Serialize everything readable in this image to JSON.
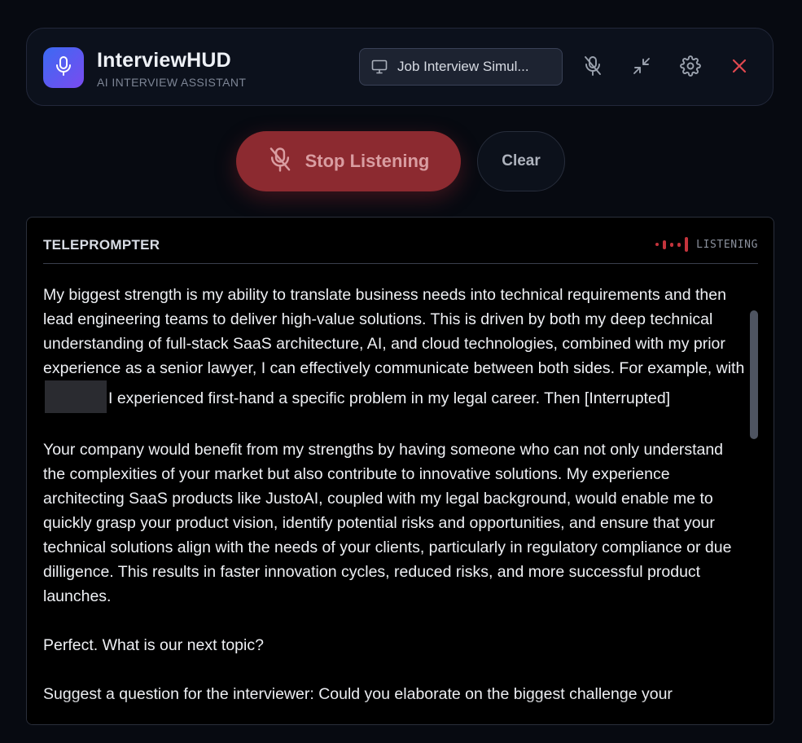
{
  "header": {
    "title": "InterviewHUD",
    "subtitle": "AI INTERVIEW ASSISTANT",
    "logo_icon": "microphone-icon",
    "mode_select": {
      "icon": "monitor-icon",
      "selected": "Job Interview Simul..."
    },
    "actions": [
      "mic-off-icon",
      "minimize-icon",
      "gear-icon",
      "close-icon"
    ]
  },
  "controls": {
    "stop_label": "Stop Listening",
    "clear_label": "Clear"
  },
  "teleprompter": {
    "title": "TELEPROMPTER",
    "status": "LISTENING",
    "paragraphs": {
      "p1_before": "My biggest strength is my ability to translate business needs into technical requirements and then lead engineering teams to deliver high-value solutions. This is driven by both my deep technical understanding of full-stack SaaS architecture, AI, and cloud technologies, combined with my prior experience as a senior lawyer, I can effectively communicate between both sides. For example, with",
      "p1_after": "I experienced first-hand a specific problem in my legal career. Then [Interrupted]",
      "p2": "Your company would benefit from my strengths by having someone who can not only understand the complexities of your market but also contribute to innovative solutions. My experience architecting SaaS products like JustoAI, coupled with my legal background, would enable me to quickly grasp your product vision, identify potential risks and opportunities, and ensure that your technical solutions align with the needs of your clients, particularly in regulatory compliance or due dilligence. This results in faster innovation cycles, reduced risks, and more successful product launches.",
      "p3": "Perfect. What is our next topic?",
      "p4": "Suggest a question for the interviewer: Could you elaborate on the biggest challenge your"
    }
  },
  "colors": {
    "accent_gradient_start": "#3b6af2",
    "accent_gradient_end": "#7a4bf0",
    "stop_button": "#8c2a30",
    "close": "#e0484f",
    "listening_indicator": "#c4343c"
  }
}
